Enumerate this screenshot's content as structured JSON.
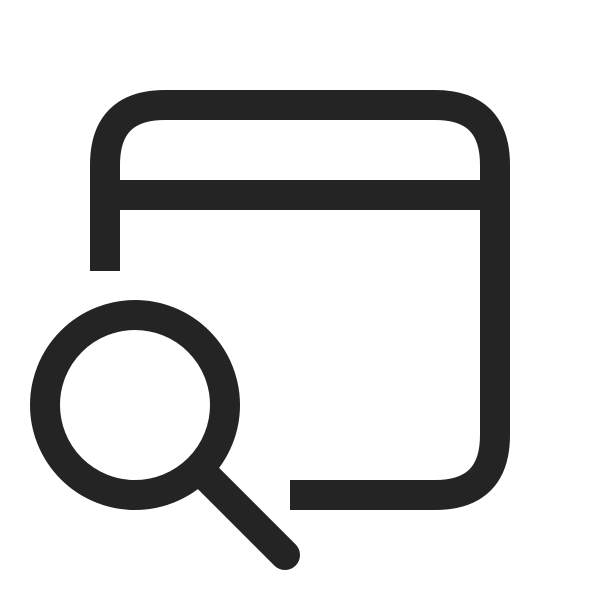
{
  "icon": {
    "name": "window-search-icon",
    "stroke_color": "#242424",
    "background_color": "#ffffff",
    "parts": [
      "window-frame-icon",
      "magnifier-icon"
    ]
  }
}
